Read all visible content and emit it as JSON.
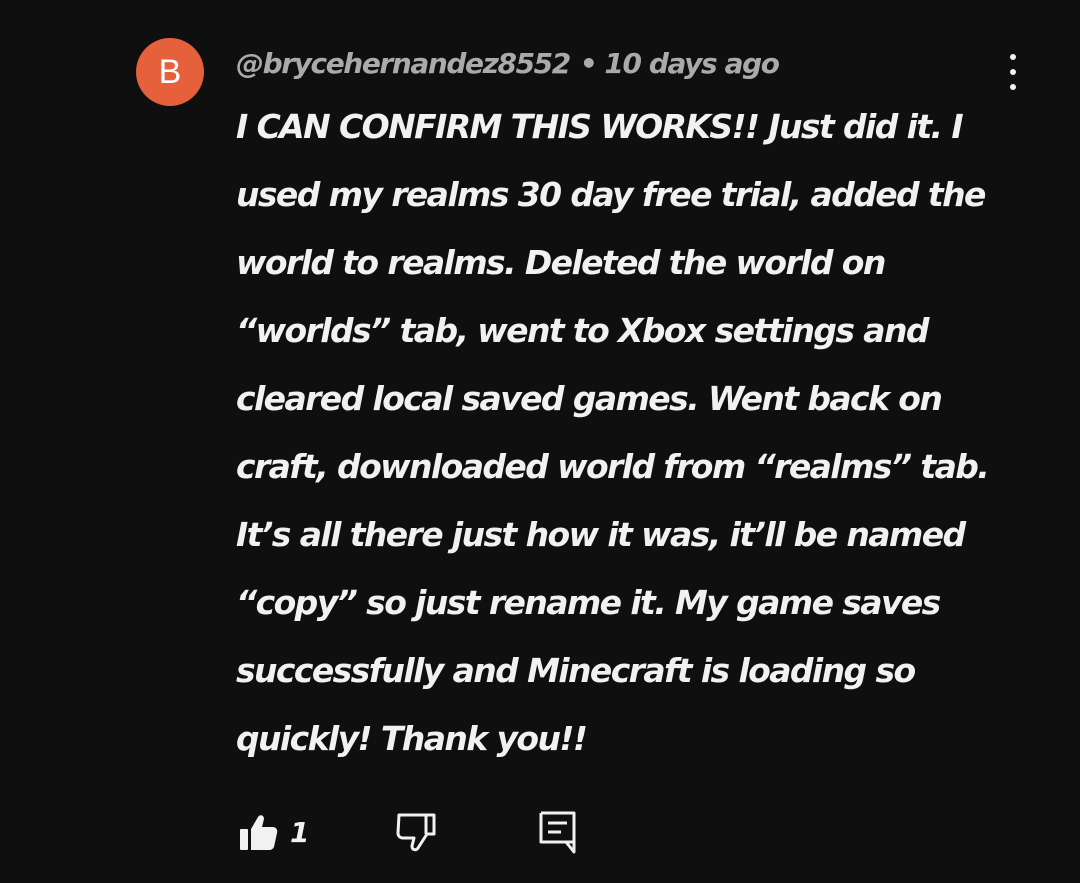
{
  "comment": {
    "avatar_letter": "B",
    "avatar_color": "#e5603b",
    "author": "@brycehernandez8552",
    "separator": "•",
    "time": "10 days ago",
    "menu_icon": "more-vert-icon",
    "text_lines": [
      "I CAN CONFIRM THIS WORKS!! Just did it. I",
      "used my realms 30 day free trial, added the",
      "world to realms. Deleted the world on",
      "“worlds” tab, went to Xbox settings and",
      "cleared local saved games. Went back on",
      "craft, downloaded world from “realms” tab.",
      "It’s all there just how it was, it’ll be named",
      "“copy” so just rename it. My game saves",
      "successfully and Minecraft is loading so",
      "quickly! Thank you!!"
    ],
    "actions": {
      "like_icon": "thumbs-up-icon",
      "like_count": "1",
      "dislike_icon": "thumbs-down-icon",
      "reply_icon": "reply-comment-icon"
    }
  }
}
